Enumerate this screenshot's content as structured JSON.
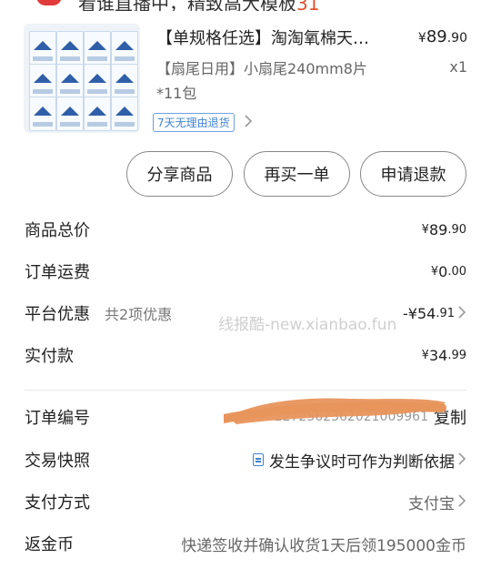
{
  "header_strip": {
    "text": "看谁直播中，精致高大模板",
    "count": "31"
  },
  "product": {
    "title": "【单规格任选】淘淘氧棉天…",
    "price": {
      "currency": "¥",
      "int": "89",
      "dec": ".90"
    },
    "spec": "【扇尾日用】小扇尾240mm8片*11包",
    "qty": "x1",
    "return_badge": "7天无理由退货"
  },
  "actions": {
    "share": "分享商品",
    "rebuy": "再买一单",
    "refund": "申请退款"
  },
  "summary": {
    "total_label": "商品总价",
    "total_int": "89",
    "total_dec": ".90",
    "shipping_label": "订单运费",
    "shipping_int": "0",
    "shipping_dec": ".00",
    "discount_label": "平台优惠",
    "discount_sub": "共2项优惠",
    "discount_int": "-¥54",
    "discount_dec": ".91",
    "paid_label": "实付款",
    "paid_int": "34",
    "paid_dec": ".99",
    "currency": "¥"
  },
  "watermark": "线报酷-new.xianbao.fun",
  "details": {
    "order_no_label": "订单编号",
    "order_no_value": "2272562362021009961",
    "copy": "复制",
    "snapshot_label": "交易快照",
    "snapshot_value": "发生争议时可作为判断依据",
    "payment_label": "支付方式",
    "payment_value": "支付宝",
    "rebate_label": "返金币",
    "rebate_value": "快递签收并确认收货1天后领195000金币"
  },
  "colors": {
    "accent_red": "#e0493b",
    "link_blue": "#3f82d4",
    "redaction": "#e8955c"
  }
}
